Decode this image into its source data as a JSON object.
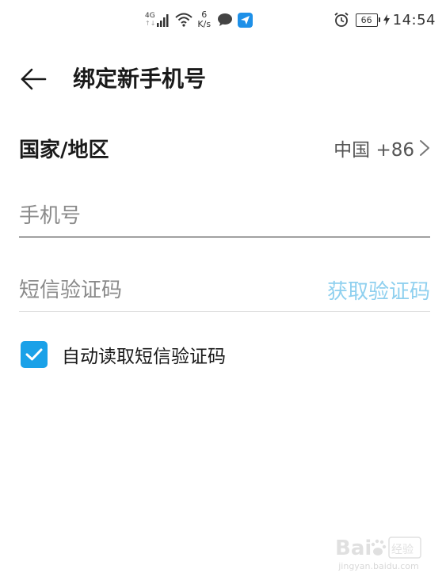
{
  "status_bar": {
    "network_type": "4G",
    "network_arrows": "↑↓",
    "net_speed_value": "6",
    "net_speed_unit": "K/s",
    "battery_level": "66",
    "time": "14:54"
  },
  "header": {
    "title": "绑定新手机号"
  },
  "country": {
    "label": "国家/地区",
    "value": "中国 +86"
  },
  "phone": {
    "placeholder": "手机号",
    "value": ""
  },
  "sms": {
    "placeholder": "短信验证码",
    "value": "",
    "get_code_label": "获取验证码"
  },
  "auto_read": {
    "label": "自动读取短信验证码",
    "checked": true
  },
  "watermark": {
    "url": "jingyan.baidu.com"
  },
  "colors": {
    "accent": "#1aa1e8",
    "get_code_disabled": "#8fd0ef",
    "text_primary": "#1a1a1a",
    "placeholder": "#8a8a8a"
  }
}
